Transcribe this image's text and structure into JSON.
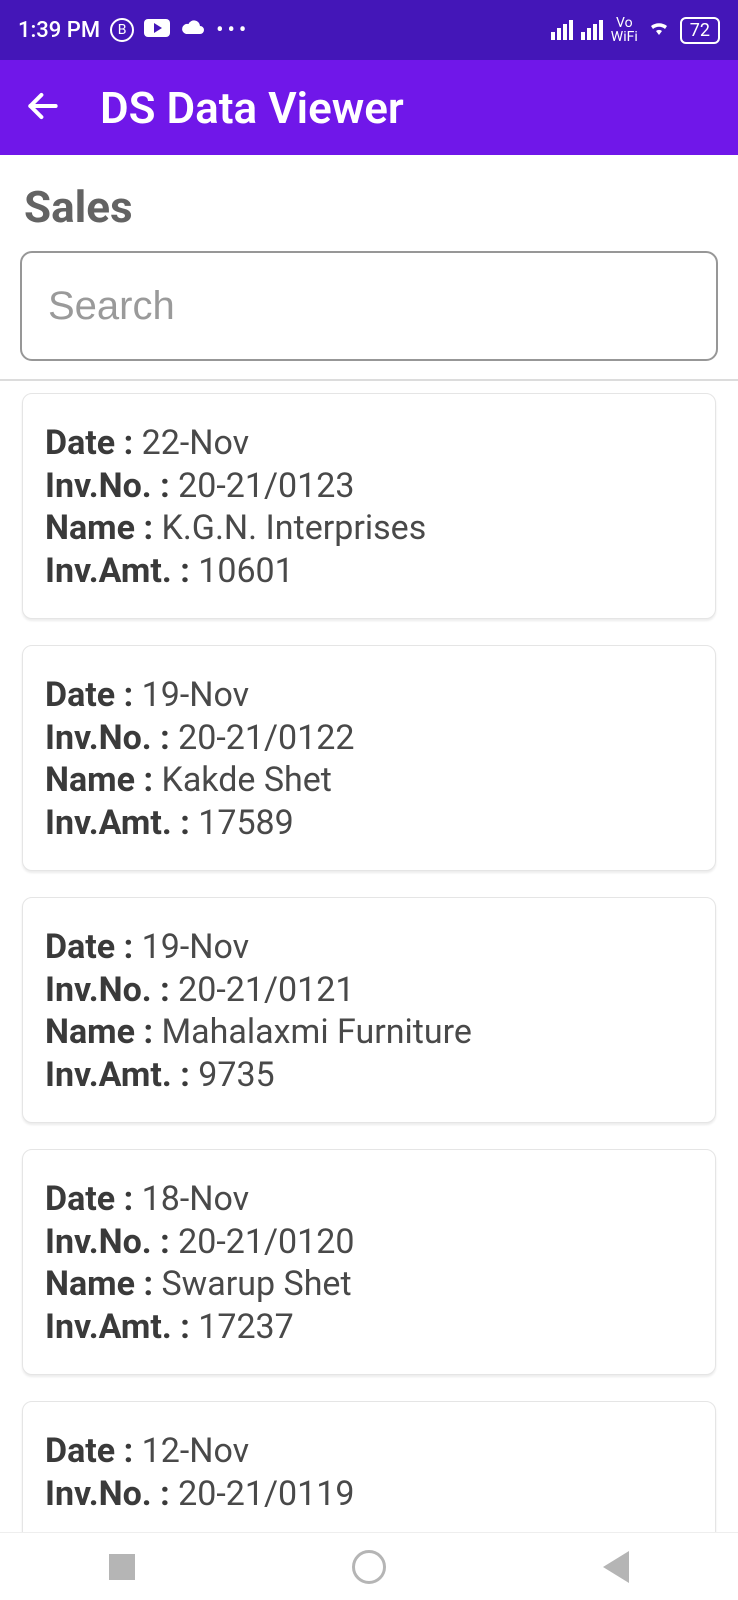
{
  "status": {
    "time": "1:39 PM",
    "battery": "72",
    "vo": "Vo",
    "wifi": "WiFi"
  },
  "appbar": {
    "title": "DS Data Viewer"
  },
  "page": {
    "title": "Sales"
  },
  "search": {
    "placeholder": "Search"
  },
  "labels": {
    "date": "Date :",
    "invno": "Inv.No. :",
    "name": "Name :",
    "invamt": "Inv.Amt. :"
  },
  "sales": [
    {
      "date": "22-Nov",
      "invno": "20-21/0123",
      "name": "K.G.N. Interprises",
      "invamt": "10601"
    },
    {
      "date": "19-Nov",
      "invno": "20-21/0122",
      "name": "Kakde Shet",
      "invamt": "17589"
    },
    {
      "date": "19-Nov",
      "invno": "20-21/0121",
      "name": "Mahalaxmi Furniture",
      "invamt": "9735"
    },
    {
      "date": "18-Nov",
      "invno": "20-21/0120",
      "name": "Swarup Shet",
      "invamt": "17237"
    },
    {
      "date": "12-Nov",
      "invno": "20-21/0119",
      "name": "",
      "invamt": ""
    }
  ]
}
